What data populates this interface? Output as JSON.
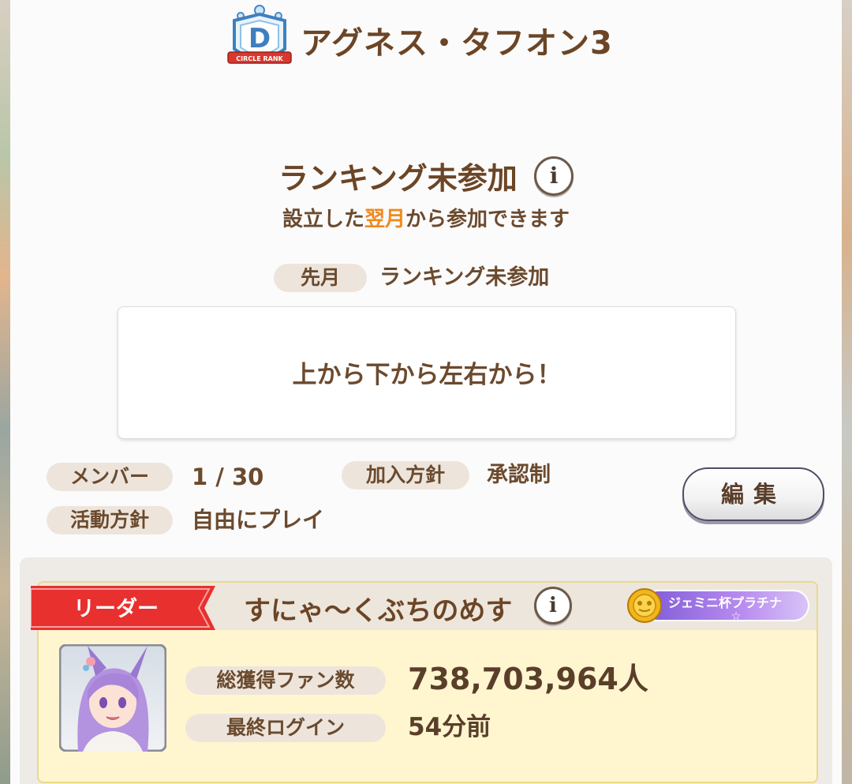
{
  "circle": {
    "rank_letter": "D",
    "rank_caption": "CIRCLE RANK",
    "name": "アグネス・タフオン3"
  },
  "ranking": {
    "status": "ランキング未参加",
    "note_before": "設立した",
    "note_highlight": "翌月",
    "note_after": "から参加できます",
    "last_month_label": "先月",
    "last_month_value": "ランキング未参加"
  },
  "message": "上から下から左右から！",
  "stats": {
    "members_label": "メンバー",
    "members_value": "1 / 30",
    "join_policy_label": "加入方針",
    "join_policy_value": "承認制",
    "activity_label": "活動方針",
    "activity_value": "自由にプレイ"
  },
  "edit_button": "編集",
  "info_glyph": "i",
  "leader": {
    "ribbon_label": "リーダー",
    "name": "すにゃ〜くぶちのめす",
    "title_badge": "ジェミニ杯プラチナ",
    "fans_label": "総獲得ファン数",
    "fans_value": "738,703,964人",
    "login_label": "最終ログイン",
    "login_value": "54分前"
  },
  "colors": {
    "text_brown": "#6b4526",
    "highlight_orange": "#f08a1e",
    "ribbon_red": "#e8302e",
    "card_yellow": "#fff6cf",
    "badge_purple": "#b07ee6"
  },
  "icons": [
    "rank-crest-icon",
    "info-icon",
    "leader-ribbon",
    "gold-medal-icon",
    "star-icon"
  ]
}
